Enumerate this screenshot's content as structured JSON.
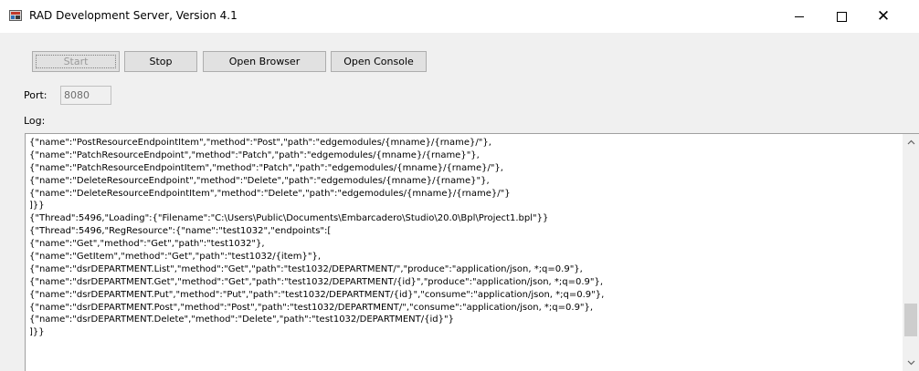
{
  "window": {
    "title": "RAD Development Server, Version 4.1",
    "minimize_glyph": "",
    "maximize_glyph": "",
    "close_glyph": "✕"
  },
  "toolbar": {
    "start_label": "Start",
    "stop_label": "Stop",
    "open_browser_label": "Open Browser",
    "open_console_label": "Open Console"
  },
  "port": {
    "label": "Port:",
    "value": "8080"
  },
  "log": {
    "label": "Log:",
    "lines": [
      "{\"name\":\"PostResourceEndpointItem\",\"method\":\"Post\",\"path\":\"edgemodules/{mname}/{rname}/\"},",
      "{\"name\":\"PatchResourceEndpoint\",\"method\":\"Patch\",\"path\":\"edgemodules/{mname}/{rname}\"},",
      "{\"name\":\"PatchResourceEndpointItem\",\"method\":\"Patch\",\"path\":\"edgemodules/{mname}/{rname}/\"},",
      "{\"name\":\"DeleteResourceEndpoint\",\"method\":\"Delete\",\"path\":\"edgemodules/{mname}/{rname}\"},",
      "{\"name\":\"DeleteResourceEndpointItem\",\"method\":\"Delete\",\"path\":\"edgemodules/{mname}/{rname}/\"}",
      "]}}",
      "{\"Thread\":5496,\"Loading\":{\"Filename\":\"C:\\Users\\Public\\Documents\\Embarcadero\\Studio\\20.0\\Bpl\\Project1.bpl\"}}",
      "{\"Thread\":5496,\"RegResource\":{\"name\":\"test1032\",\"endpoints\":[",
      "{\"name\":\"Get\",\"method\":\"Get\",\"path\":\"test1032\"},",
      "{\"name\":\"GetItem\",\"method\":\"Get\",\"path\":\"test1032/{item}\"},",
      "{\"name\":\"dsrDEPARTMENT.List\",\"method\":\"Get\",\"path\":\"test1032/DEPARTMENT/\",\"produce\":\"application/json, *;q=0.9\"},",
      "{\"name\":\"dsrDEPARTMENT.Get\",\"method\":\"Get\",\"path\":\"test1032/DEPARTMENT/{id}\",\"produce\":\"application/json, *;q=0.9\"},",
      "{\"name\":\"dsrDEPARTMENT.Put\",\"method\":\"Put\",\"path\":\"test1032/DEPARTMENT/{id}\",\"consume\":\"application/json, *;q=0.9\"},",
      "{\"name\":\"dsrDEPARTMENT.Post\",\"method\":\"Post\",\"path\":\"test1032/DEPARTMENT/\",\"consume\":\"application/json, *;q=0.9\"},",
      "{\"name\":\"dsrDEPARTMENT.Delete\",\"method\":\"Delete\",\"path\":\"test1032/DEPARTMENT/{id}\"}",
      "]}}"
    ]
  },
  "icons": {
    "app": "server-app-icon",
    "scroll_up": "chevron-up-icon",
    "scroll_down": "chevron-down-icon"
  }
}
